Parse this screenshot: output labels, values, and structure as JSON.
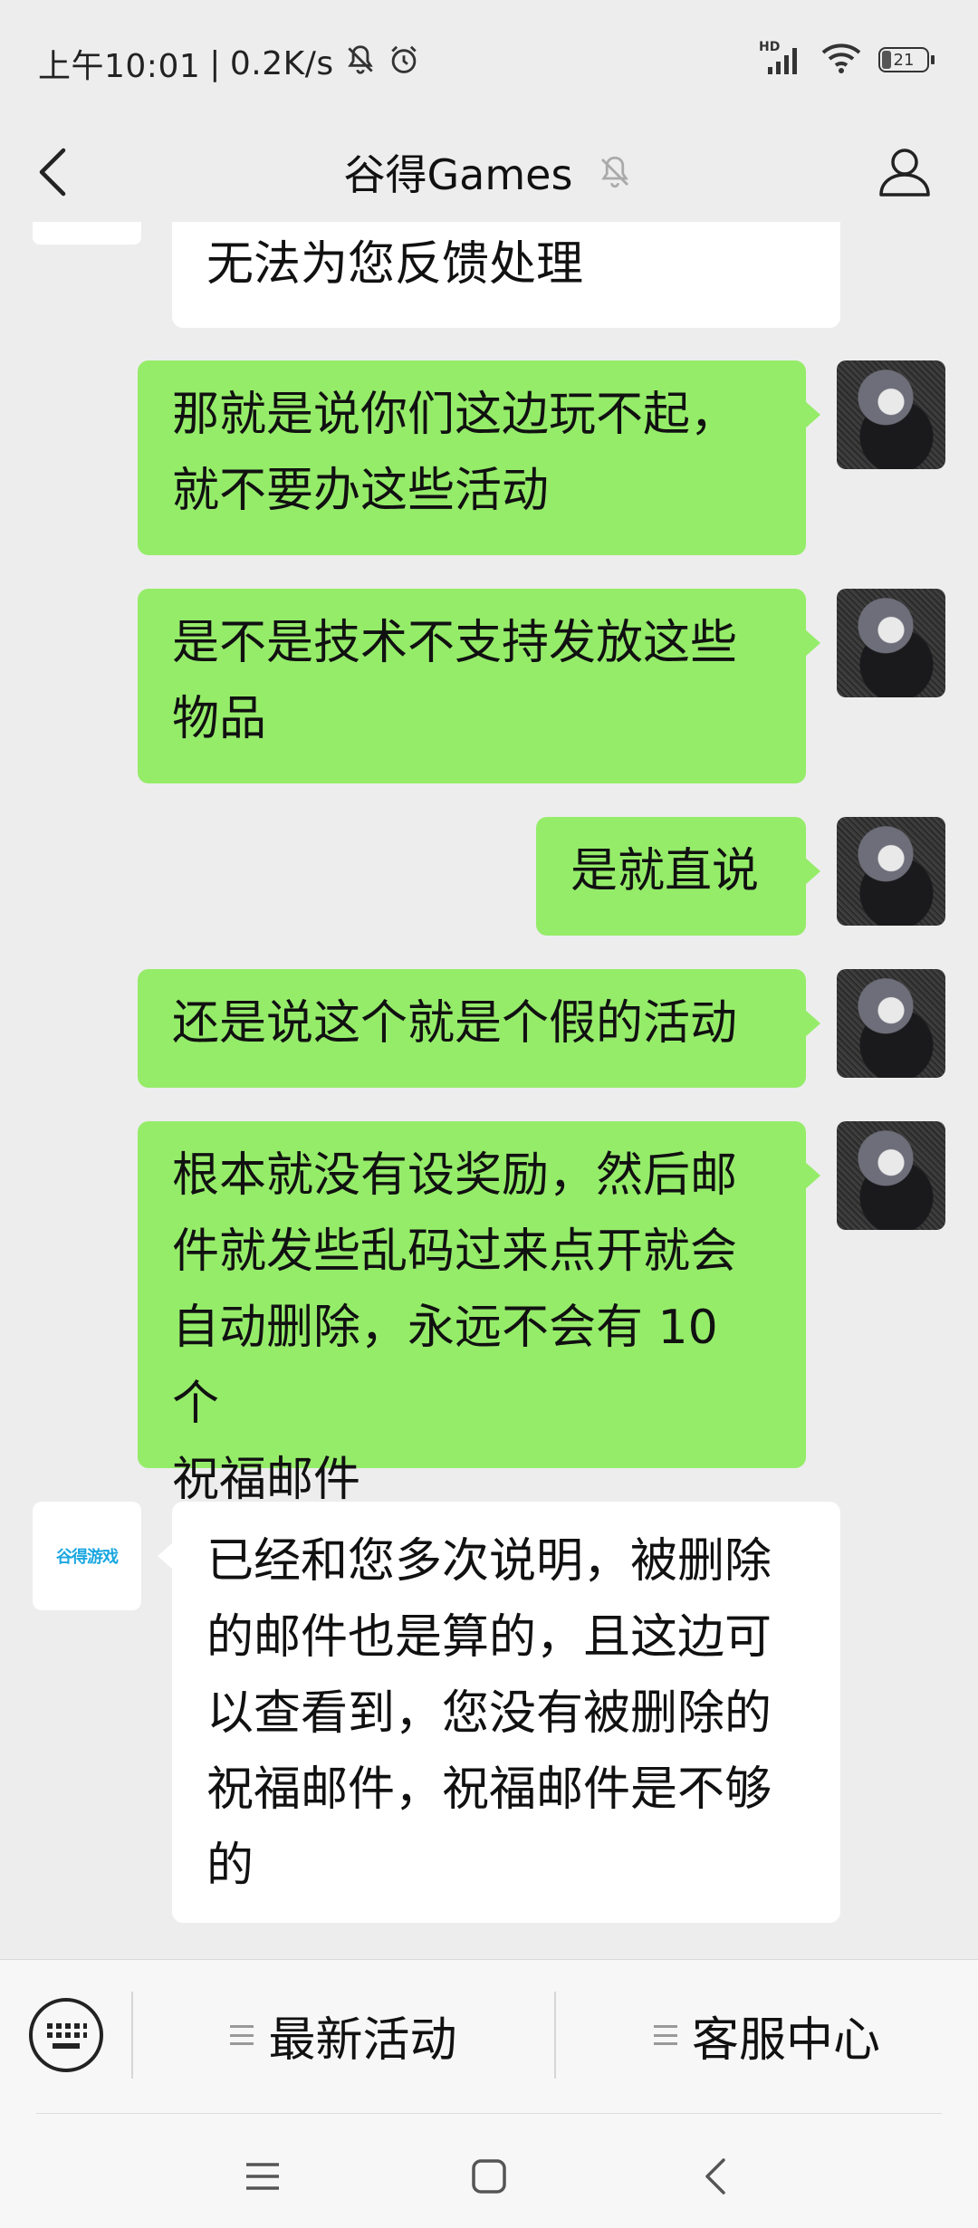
{
  "status_bar": {
    "time": "上午10:01",
    "separator": "|",
    "net_speed": "0.2K/s",
    "signal_label": "HD",
    "battery": "21"
  },
  "header": {
    "title": "谷得Games",
    "icons": {
      "back": "chevron-left-icon",
      "mute": "bell-muted-icon",
      "profile": "person-icon"
    }
  },
  "messages": [
    {
      "side": "left",
      "text": "无法为您反馈处理",
      "partial": true
    },
    {
      "side": "right",
      "lines": [
        "那就是说你们这边玩不起，",
        "就不要办这些活动"
      ]
    },
    {
      "side": "right",
      "lines": [
        "是不是技术不支持发放这些",
        "物品"
      ]
    },
    {
      "side": "right",
      "lines": [
        "是就直说"
      ]
    },
    {
      "side": "right",
      "lines": [
        "还是说这个就是个假的活动"
      ]
    },
    {
      "side": "right",
      "lines": [
        "根本就没有设奖励，然后邮",
        "件就发些乱码过来点开就会",
        "自动删除，永远不会有 10 个",
        "祝福邮件"
      ]
    },
    {
      "side": "left",
      "sender_logo": "谷得游戏",
      "lines": [
        "已经和您多次说明，被删除",
        "的邮件也是算的，且这边可",
        "以查看到，您没有被删除的",
        "祝福邮件，祝福邮件是不够",
        "的"
      ]
    }
  ],
  "bottom_menu": {
    "keyboard_icon": "keyboard-icon",
    "items": [
      {
        "label": "最新活动"
      },
      {
        "label": "客服中心"
      }
    ]
  },
  "system_nav": {
    "icons": [
      "menu-icon",
      "home-icon",
      "back-icon"
    ]
  }
}
